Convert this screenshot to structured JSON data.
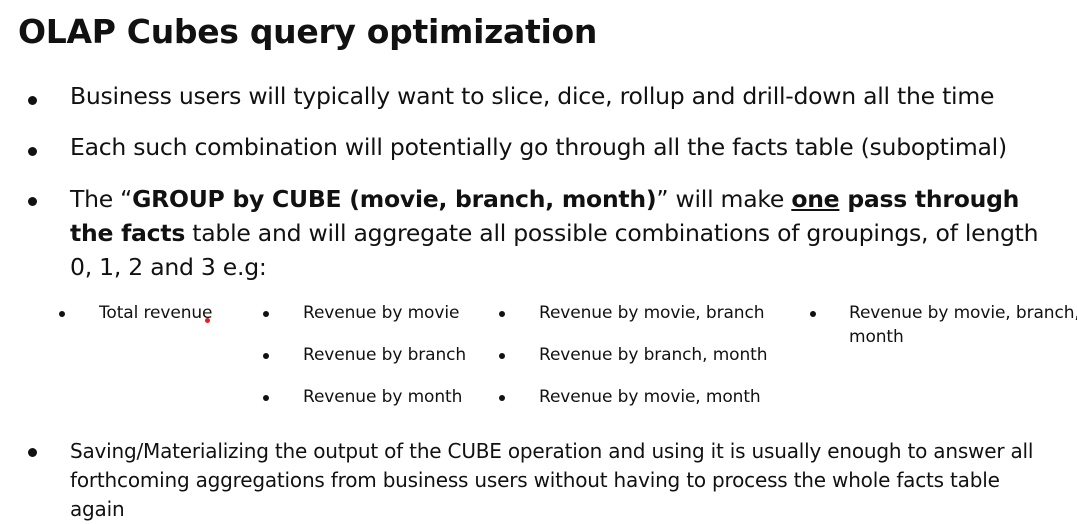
{
  "title": "OLAP Cubes query optimization",
  "bullets": [
    "Business users will typically want to slice, dice, rollup and drill-down all the time",
    "Each such combination will potentially go through all the facts table (suboptimal)"
  ],
  "bullet3": {
    "p1": "The “",
    "b1": "GROUP by CUBE (movie, branch, month)",
    "p2": "” will  make ",
    "u1": "one",
    "b2": " pass through the facts",
    "p3": " table and will aggregate all possible combinations of  groupings, of length 0, 1, 2 and 3 e.g:"
  },
  "groupings": {
    "col0": [
      "Total revenue"
    ],
    "col1": [
      "Revenue by movie",
      "Revenue by branch",
      "Revenue by month"
    ],
    "col2": [
      "Revenue by movie, branch",
      "Revenue by branch, month",
      "Revenue by movie, month"
    ],
    "col3_line1": "Revenue by movie, branch,",
    "col3_line2": "month"
  },
  "last_bullet": "Saving/Materializing the output of the CUBE operation and using it is usually enough to answer all forthcoming aggregations from business users without having to process the whole facts table again"
}
